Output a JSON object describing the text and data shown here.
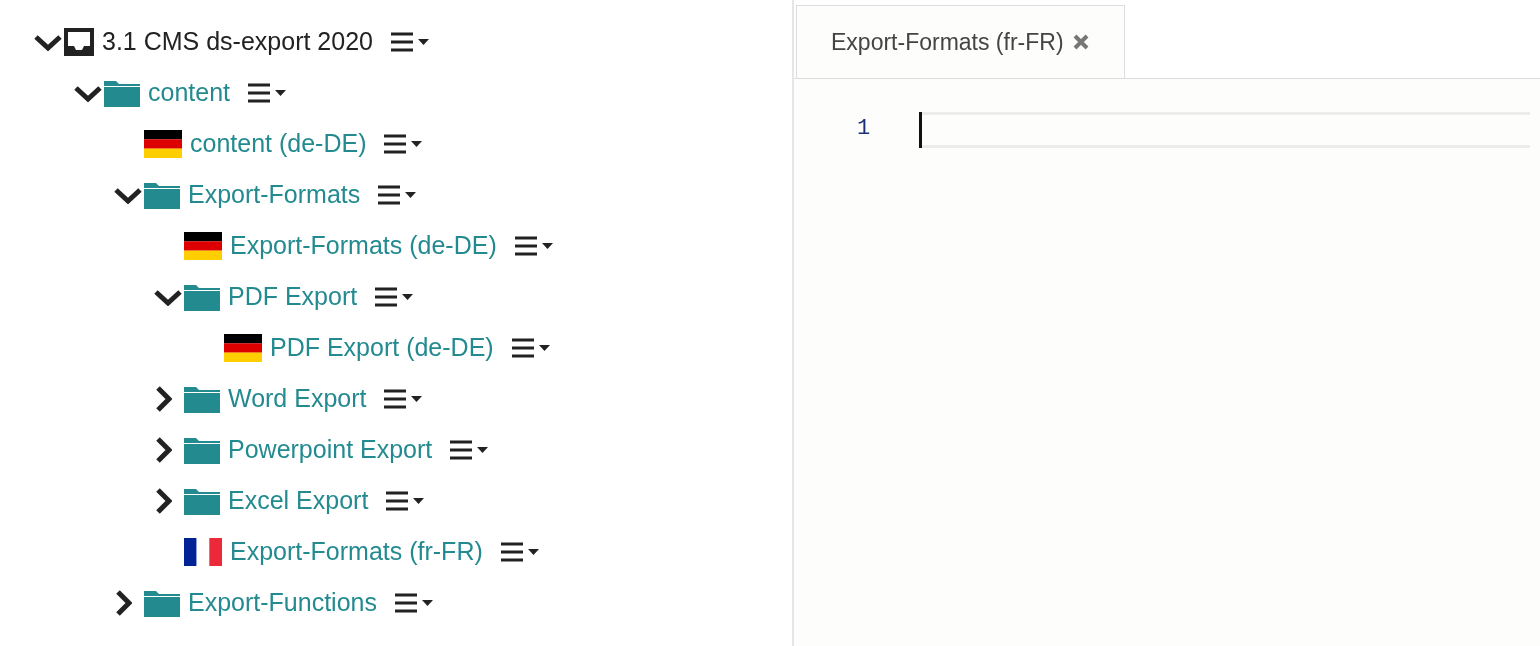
{
  "tree": [
    {
      "kind": "root",
      "label": "3.1 CMS ds-export 2020",
      "expanded": true,
      "children": [
        {
          "kind": "folder",
          "label": "content",
          "expanded": true,
          "children": [
            {
              "kind": "german_locale",
              "label": "content (de-DE)"
            },
            {
              "kind": "folder",
              "label": "Export-Formats",
              "expanded": true,
              "children": [
                {
                  "kind": "german_locale",
                  "label": "Export-Formats (de-DE)"
                },
                {
                  "kind": "folder",
                  "label": "PDF Export",
                  "expanded": true,
                  "children": [
                    {
                      "kind": "german_locale",
                      "label": "PDF Export (de-DE)"
                    }
                  ]
                },
                {
                  "kind": "folder",
                  "label": "Word Export",
                  "expanded": false
                },
                {
                  "kind": "folder",
                  "label": "Powerpoint Export",
                  "expanded": false
                },
                {
                  "kind": "folder",
                  "label": "Excel Export",
                  "expanded": false
                },
                {
                  "kind": "french_locale",
                  "label": "Export-Formats (fr-FR)"
                }
              ]
            },
            {
              "kind": "folder",
              "label": "Export-Functions",
              "expanded": false
            }
          ]
        }
      ]
    }
  ],
  "tabs": [
    {
      "label": "Export-Formats (fr-FR)",
      "selected": true
    }
  ],
  "editor": {
    "line_numbers": [
      "1"
    ]
  }
}
